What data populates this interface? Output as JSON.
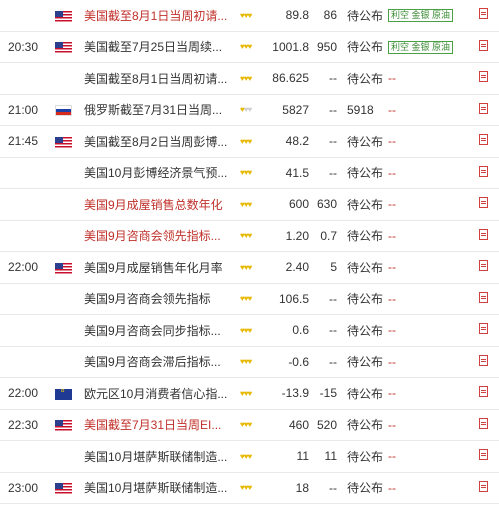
{
  "rows": [
    {
      "time": "",
      "flag": "us",
      "name": "美国截至8月1日当周初请...",
      "hl": true,
      "stars": 3,
      "actual": "89.8",
      "forecast": "86",
      "status": "待公布",
      "effect": "",
      "badge": "利空 金银 原油"
    },
    {
      "time": "20:30",
      "flag": "us",
      "name": "美国截至7月25日当周续...",
      "hl": false,
      "stars": 3,
      "actual": "1001.8",
      "forecast": "950",
      "status": "待公布",
      "effect": "",
      "badge": "利空 金银 原油"
    },
    {
      "time": "",
      "flag": "",
      "name": "美国截至8月1日当周初请...",
      "hl": false,
      "stars": 3,
      "actual": "86.625",
      "forecast": "--",
      "status": "待公布",
      "effect": "--",
      "badge": ""
    },
    {
      "time": "21:00",
      "flag": "ru",
      "name": "俄罗斯截至7月31日当周...",
      "hl": false,
      "stars": 1,
      "actual": "5827",
      "forecast": "--",
      "status": "5918",
      "effect": "--",
      "badge": ""
    },
    {
      "time": "21:45",
      "flag": "us",
      "name": "美国截至8月2日当周彭博...",
      "hl": false,
      "stars": 3,
      "actual": "48.2",
      "forecast": "--",
      "status": "待公布",
      "effect": "--",
      "badge": ""
    },
    {
      "time": "",
      "flag": "",
      "name": "美国10月彭博经济景气预...",
      "hl": false,
      "stars": 3,
      "actual": "41.5",
      "forecast": "--",
      "status": "待公布",
      "effect": "--",
      "badge": ""
    },
    {
      "time": "",
      "flag": "",
      "name": "美国9月成屋销售总数年化",
      "hl": true,
      "stars": 3,
      "actual": "600",
      "forecast": "630",
      "status": "待公布",
      "effect": "--",
      "badge": ""
    },
    {
      "time": "",
      "flag": "",
      "name": "美国9月咨商会领先指标...",
      "hl": true,
      "stars": 3,
      "actual": "1.20",
      "forecast": "0.7",
      "status": "待公布",
      "effect": "--",
      "badge": ""
    },
    {
      "time": "22:00",
      "flag": "us",
      "name": "美国9月成屋销售年化月率",
      "hl": false,
      "stars": 3,
      "actual": "2.40",
      "forecast": "5",
      "status": "待公布",
      "effect": "--",
      "badge": ""
    },
    {
      "time": "",
      "flag": "",
      "name": "美国9月咨商会领先指标",
      "hl": false,
      "stars": 3,
      "actual": "106.5",
      "forecast": "--",
      "status": "待公布",
      "effect": "--",
      "badge": ""
    },
    {
      "time": "",
      "flag": "",
      "name": "美国9月咨商会同步指标...",
      "hl": false,
      "stars": 3,
      "actual": "0.6",
      "forecast": "--",
      "status": "待公布",
      "effect": "--",
      "badge": ""
    },
    {
      "time": "",
      "flag": "",
      "name": "美国9月咨商会滞后指标...",
      "hl": false,
      "stars": 3,
      "actual": "-0.6",
      "forecast": "--",
      "status": "待公布",
      "effect": "--",
      "badge": ""
    },
    {
      "time": "22:00",
      "flag": "eu",
      "name": "欧元区10月消费者信心指...",
      "hl": false,
      "stars": 3,
      "actual": "-13.9",
      "forecast": "-15",
      "status": "待公布",
      "effect": "--",
      "badge": ""
    },
    {
      "time": "22:30",
      "flag": "us",
      "name": "美国截至7月31日当周EI...",
      "hl": true,
      "stars": 3,
      "actual": "460",
      "forecast": "520",
      "status": "待公布",
      "effect": "--",
      "badge": ""
    },
    {
      "time": "",
      "flag": "",
      "name": "美国10月堪萨斯联储制造...",
      "hl": false,
      "stars": 3,
      "actual": "11",
      "forecast": "11",
      "status": "待公布",
      "effect": "--",
      "badge": ""
    },
    {
      "time": "23:00",
      "flag": "us",
      "name": "美国10月堪萨斯联储制造...",
      "hl": false,
      "stars": 3,
      "actual": "18",
      "forecast": "--",
      "status": "待公布",
      "effect": "--",
      "badge": ""
    }
  ]
}
